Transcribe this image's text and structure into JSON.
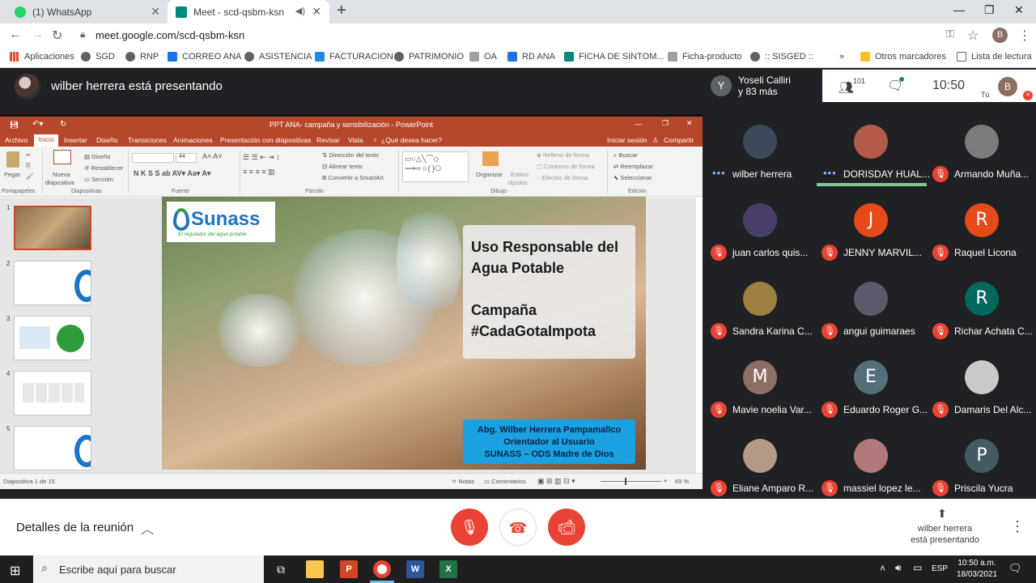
{
  "browser": {
    "tabs": [
      {
        "title": "(1) WhatsApp",
        "favicon_color": "#25d366"
      },
      {
        "title": "Meet - scd-qsbm-ksn",
        "favicon_color": "#00897b"
      }
    ],
    "new_tab": "+",
    "url": "meet.google.com/scd-qsbm-ksn",
    "profile_initial": "B",
    "bookmarks": [
      "Aplicaciones",
      "SGD",
      "RNP",
      "CORREO ANA",
      "ASISTENCIA",
      "FACTURACION",
      "PATRIMONIO",
      "OA",
      "RD ANA",
      "FICHA DE SINTOM...",
      "Ficha-producto",
      ":: SISGED ::",
      "»",
      "Otros marcadores",
      "Lista de lectura"
    ]
  },
  "meet": {
    "presenter_banner": "wilber herrera está presentando",
    "people_count": "101",
    "clock": "10:50",
    "you_label": "Tú",
    "you_initial": "B",
    "top_participant": {
      "initial": "Y",
      "name_line1": "Yoseli Calliri",
      "name_line2": "y 83 más"
    },
    "participants": [
      {
        "name": "wilber herrera",
        "initial": "",
        "color": "#3a4a5a",
        "muted": false,
        "speaking": false
      },
      {
        "name": "DORISDAY HUAL...",
        "initial": "",
        "color": "#b35a4a",
        "muted": false,
        "speaking": true
      },
      {
        "name": "Armando Muña...",
        "initial": "",
        "color": "#7c7c7c",
        "muted": true,
        "speaking": false
      },
      {
        "name": "juan carlos quis...",
        "initial": "",
        "color": "#4a3d6a",
        "muted": true,
        "speaking": false
      },
      {
        "name": "JENNY MARVIL...",
        "initial": "J",
        "color": "#e64a19",
        "muted": true,
        "speaking": false
      },
      {
        "name": "Raquel Licona",
        "initial": "R",
        "color": "#e64a19",
        "muted": true,
        "speaking": false
      },
      {
        "name": "Sandra Karina C...",
        "initial": "",
        "color": "#a08040",
        "muted": true,
        "speaking": false
      },
      {
        "name": "angui guimaraes",
        "initial": "",
        "color": "#5a5a6a",
        "muted": true,
        "speaking": false
      },
      {
        "name": "Richar Achata C...",
        "initial": "R",
        "color": "#00695c",
        "muted": true,
        "speaking": false
      },
      {
        "name": "Mavie noelia Var...",
        "initial": "M",
        "color": "#8d6e63",
        "muted": true,
        "speaking": false
      },
      {
        "name": "Eduardo Roger G...",
        "initial": "E",
        "color": "#546e7a",
        "muted": true,
        "speaking": false
      },
      {
        "name": "Damaris Del Alc...",
        "initial": "",
        "color": "#c9c9c9",
        "muted": true,
        "speaking": false
      },
      {
        "name": "Eliane Amparo R...",
        "initial": "",
        "color": "#b49a8a",
        "muted": true,
        "speaking": false
      },
      {
        "name": "massiel lopez le...",
        "initial": "",
        "color": "#b07a7a",
        "muted": true,
        "speaking": false
      },
      {
        "name": "Priscila Yucra",
        "initial": "P",
        "color": "#455a64",
        "muted": true,
        "speaking": false
      }
    ],
    "details_label": "Detalles de la reunión",
    "present_label_1": "wilber herrera",
    "present_label_2": "está presentando"
  },
  "powerpoint": {
    "title": "PPT ANA- campaña y sensibilización - PowerPoint",
    "sign_in": "Iniciar sesión",
    "share": "Compartir",
    "tabs": [
      "Archivo",
      "Inicio",
      "Insertar",
      "Diseño",
      "Transiciones",
      "Animaciones",
      "Presentación con diapositivas",
      "Revisar",
      "Vista"
    ],
    "tell_me": "¿Qué desea hacer?",
    "ribbon": {
      "paste": "Pegar",
      "new_slide_1": "Nueva",
      "new_slide_2": "diapositiva",
      "layout": "Diseño",
      "reset": "Restablecer",
      "section": "Sección",
      "groups": [
        "Portapapeles",
        "Diapositivas",
        "Fuente",
        "Párrafo",
        "Dibujo",
        "Edición"
      ],
      "font_size": "44",
      "text_direction": "Dirección del texto",
      "align_text": "Alinear texto",
      "smartart": "Convertir a SmartArt",
      "organize": "Organizar",
      "quick_styles_1": "Estilos",
      "quick_styles_2": "rápidos",
      "shape_fill": "Relleno de forma",
      "shape_outline": "Contorno de forma",
      "shape_effects": "Efectos de forma",
      "find": "Buscar",
      "replace": "Reemplazar",
      "select": "Seleccionar"
    },
    "thumbnails": [
      "1",
      "2",
      "3",
      "4",
      "5"
    ],
    "slide": {
      "logo_word": "Sunass",
      "logo_tagline": "El regulador del agua potable",
      "heading_line1": "Uso Responsable del",
      "heading_line2": "Agua Potable",
      "heading_line3": "Campaña",
      "heading_line4": "#CadaGotaImpota",
      "credit_line1": "Abg. Wilber Herrera Pampamallco",
      "credit_line2": "Orientador al Usuario",
      "credit_line3": "SUNASS – ODS Madre de Dios"
    },
    "status": {
      "slide_count": "Diapositiva 1 de 15",
      "notes": "Notas",
      "comments": "Comentarios",
      "zoom": "69 %"
    }
  },
  "taskbar": {
    "search_placeholder": "Escribe aquí para buscar",
    "language": "ESP",
    "time": "10:50 a.m.",
    "date": "18/03/2021"
  }
}
